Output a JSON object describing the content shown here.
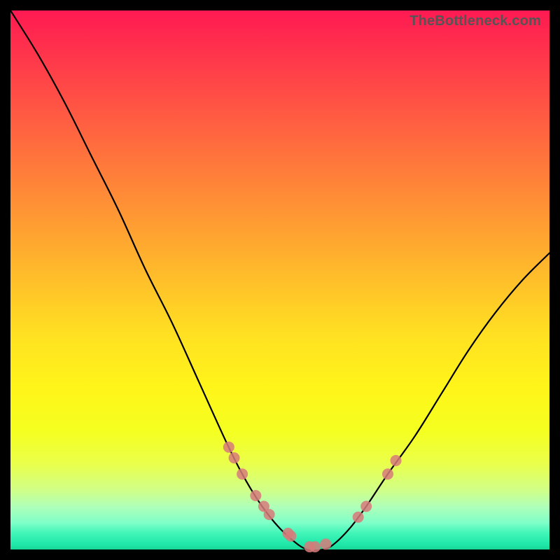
{
  "watermark": "TheBottleneck.com",
  "chart_data": {
    "type": "line",
    "title": "",
    "xlabel": "",
    "ylabel": "",
    "xlim": [
      0,
      1
    ],
    "ylim": [
      0,
      1
    ],
    "grid": false,
    "legend": false,
    "series": [
      {
        "name": "bottleneck-curve",
        "x": [
          0.0,
          0.05,
          0.1,
          0.15,
          0.2,
          0.25,
          0.3,
          0.35,
          0.4,
          0.43,
          0.46,
          0.49,
          0.52,
          0.55,
          0.58,
          0.6,
          0.63,
          0.66,
          0.7,
          0.75,
          0.8,
          0.85,
          0.9,
          0.95,
          1.0
        ],
        "y": [
          1.0,
          0.92,
          0.83,
          0.73,
          0.63,
          0.52,
          0.42,
          0.31,
          0.2,
          0.14,
          0.09,
          0.05,
          0.02,
          0.0,
          0.0,
          0.01,
          0.04,
          0.08,
          0.14,
          0.21,
          0.29,
          0.37,
          0.44,
          0.5,
          0.55
        ]
      }
    ],
    "markers": {
      "name": "highlight-dots",
      "color": "#d77a7a",
      "x": [
        0.405,
        0.415,
        0.43,
        0.455,
        0.47,
        0.48,
        0.515,
        0.52,
        0.555,
        0.565,
        0.585,
        0.645,
        0.66,
        0.7,
        0.715
      ],
      "y": [
        0.19,
        0.17,
        0.14,
        0.1,
        0.08,
        0.065,
        0.03,
        0.025,
        0.005,
        0.005,
        0.01,
        0.06,
        0.08,
        0.14,
        0.165
      ]
    },
    "background_gradient": {
      "orientation": "vertical",
      "stops": [
        {
          "pos": 0.0,
          "color": "#ff1a52"
        },
        {
          "pos": 0.5,
          "color": "#ffbf2a"
        },
        {
          "pos": 0.8,
          "color": "#f5ff20"
        },
        {
          "pos": 1.0,
          "color": "#18d898"
        }
      ]
    }
  }
}
